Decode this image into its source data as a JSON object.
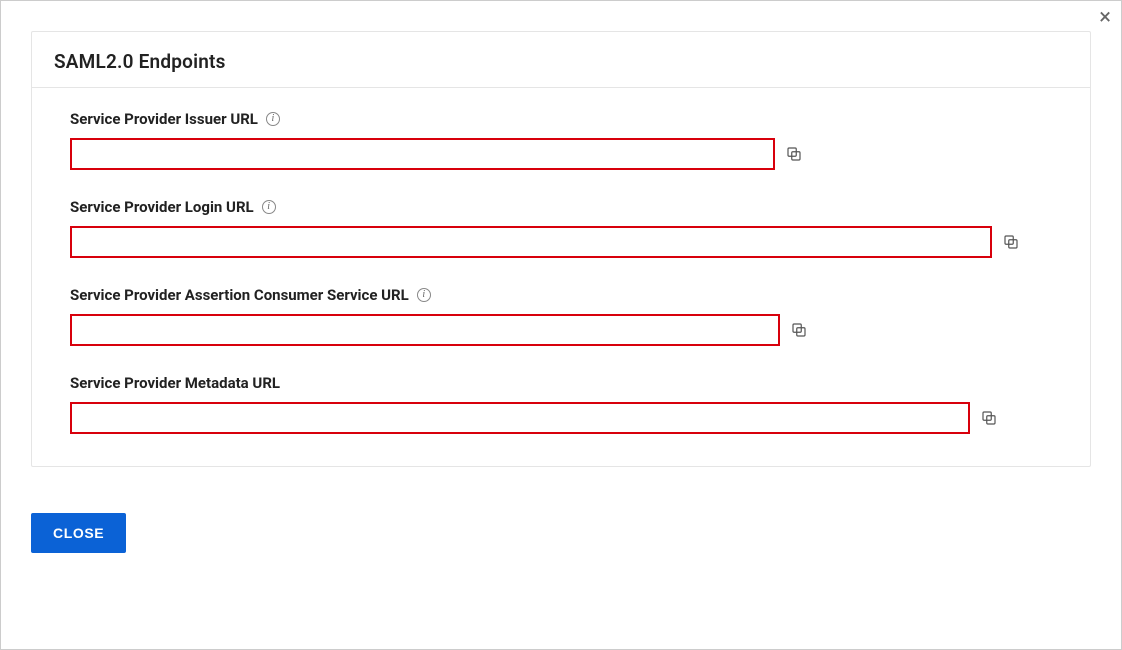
{
  "dialog": {
    "title": "SAML2.0 Endpoints",
    "close_button_label": "CLOSE"
  },
  "fields": {
    "issuer": {
      "label": "Service Provider Issuer URL",
      "value": "",
      "has_info": true
    },
    "login": {
      "label": "Service Provider Login URL",
      "value": "",
      "has_info": true
    },
    "acs": {
      "label": "Service Provider Assertion Consumer Service URL",
      "value": "",
      "has_info": true
    },
    "metadata": {
      "label": "Service Provider Metadata URL",
      "value": "",
      "has_info": false
    }
  },
  "colors": {
    "accent": "#0b62d6",
    "highlight_border": "#d8000c"
  }
}
